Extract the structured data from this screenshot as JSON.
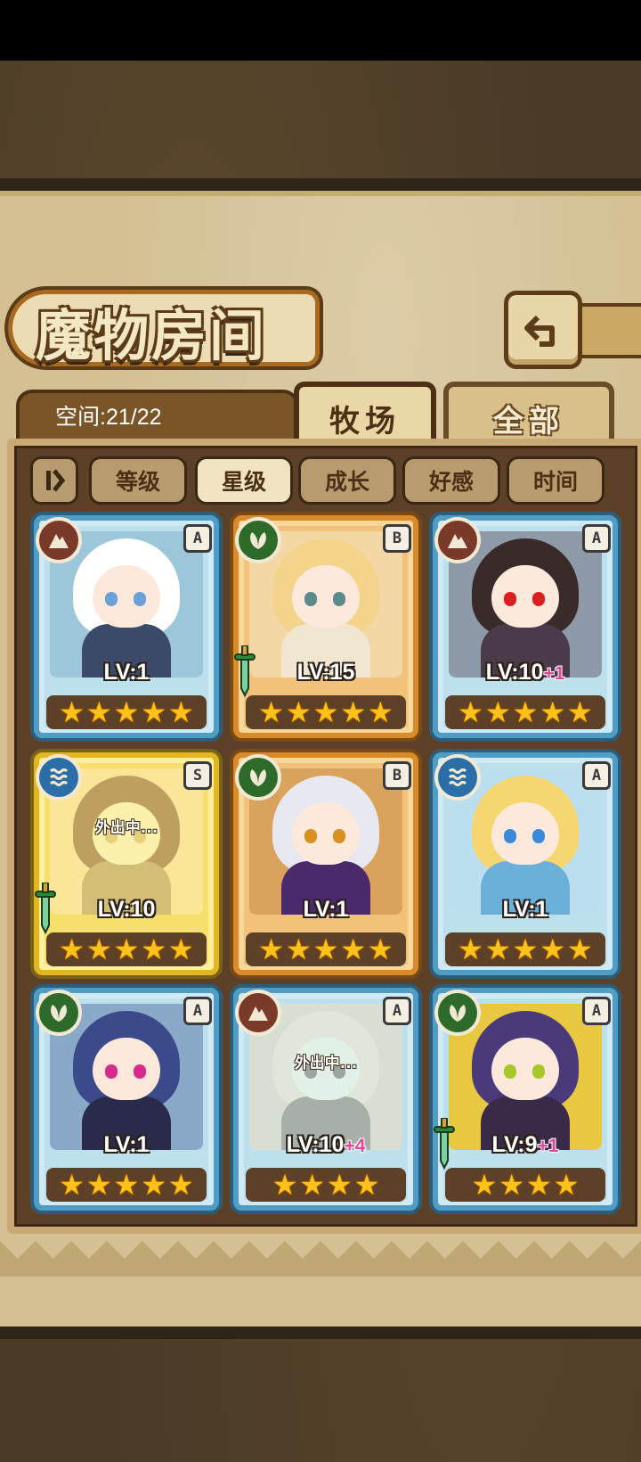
{
  "header": {
    "title": "魔物房间",
    "back_icon": "return-arrow-icon"
  },
  "info": {
    "space_label": "空间:21/22"
  },
  "tabs": [
    {
      "label": "牧场",
      "active": true
    },
    {
      "label": "全部",
      "active": false
    }
  ],
  "sort": {
    "toggle_icon": "sort-order-icon",
    "buttons": [
      {
        "label": "等级",
        "active": false
      },
      {
        "label": "星级",
        "active": true
      },
      {
        "label": "成长",
        "active": false
      },
      {
        "label": "好感",
        "active": false
      },
      {
        "label": "时间",
        "active": false
      }
    ]
  },
  "monsters": [
    {
      "element": "earth",
      "rank": "A",
      "level": "LV:1",
      "bonus": "",
      "stars": 5,
      "away": false,
      "weapon": false
    },
    {
      "element": "nature",
      "rank": "B",
      "level": "LV:15",
      "bonus": "",
      "stars": 5,
      "away": false,
      "weapon": true
    },
    {
      "element": "earth",
      "rank": "A",
      "level": "LV:10",
      "bonus": "+1",
      "stars": 5,
      "away": false,
      "weapon": false
    },
    {
      "element": "water",
      "rank": "S",
      "level": "LV:10",
      "bonus": "",
      "stars": 5,
      "away": true,
      "away_text": "外出中...",
      "weapon": true
    },
    {
      "element": "nature",
      "rank": "B",
      "level": "LV:1",
      "bonus": "",
      "stars": 5,
      "away": false,
      "weapon": false
    },
    {
      "element": "water",
      "rank": "A",
      "level": "LV:1",
      "bonus": "",
      "stars": 5,
      "away": false,
      "weapon": false
    },
    {
      "element": "nature",
      "rank": "A",
      "level": "LV:1",
      "bonus": "",
      "stars": 5,
      "away": false,
      "weapon": false
    },
    {
      "element": "earth",
      "rank": "A",
      "level": "LV:10",
      "bonus": "+4",
      "stars": 4,
      "away": true,
      "away_text": "外出中...",
      "weapon": false
    },
    {
      "element": "nature",
      "rank": "A",
      "level": "LV:9",
      "bonus": "+1",
      "stars": 4,
      "away": false,
      "weapon": true
    }
  ],
  "colors": {
    "panel": "#d4c093",
    "list_bg": "#5c4128",
    "star": "#ffc21a",
    "bonus": "#e0479a"
  }
}
